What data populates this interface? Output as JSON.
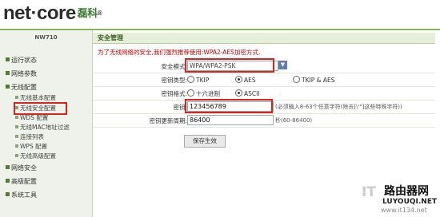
{
  "logo": {
    "text": "net·core",
    "cn": "磊科",
    "tm": "®"
  },
  "sidebar": {
    "model": "NW710",
    "items": [
      {
        "label": "运行状态"
      },
      {
        "label": "网络参数"
      },
      {
        "label": "无线配置"
      },
      {
        "label": "无线基本配置"
      },
      {
        "label": "无线安全配置"
      },
      {
        "label": "WDS 配置"
      },
      {
        "label": "无线MAC地址过滤"
      },
      {
        "label": "连接列表"
      },
      {
        "label": "WPS 配置"
      },
      {
        "label": "无线高级配置"
      },
      {
        "label": "网络安全"
      },
      {
        "label": "高级配置"
      },
      {
        "label": "系统工具"
      }
    ]
  },
  "main": {
    "title": "安全管理",
    "notice": "为了无线网络的安全,我们强烈推荐使用:WPA2-AES加密方式.",
    "fields": {
      "security_mode": {
        "label": "安全模式:",
        "value": "WPA/WPA2-PSK"
      },
      "cipher_type": {
        "label": "密钥类型:",
        "options": [
          "TKIP",
          "AES",
          "TKIP & AES"
        ],
        "selected": "AES"
      },
      "key_format": {
        "label": "密钥格式:",
        "options": [
          "十六进制",
          "ASCII"
        ],
        "selected": "ASCII"
      },
      "password": {
        "label": "密钥:",
        "value": "123456789",
        "hint": "(必须输入8-63个任意字符(除去[\\'\"]这些特殊字符))"
      },
      "rekey_period": {
        "label": "密钥更新周期:",
        "value": "86400",
        "unit": "秒(60-86400)"
      }
    },
    "save_label": "保存生效"
  },
  "watermark": {
    "line1": "路由器网",
    "line2": "LUYOUQI.NET",
    "it": "IT",
    "line3": "www.it134.net"
  }
}
